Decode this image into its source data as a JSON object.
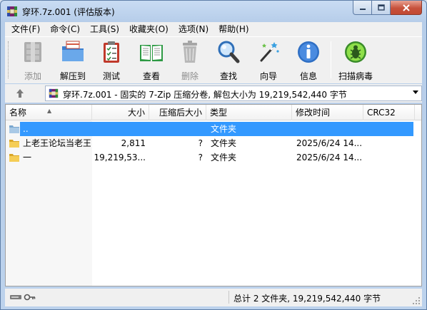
{
  "window": {
    "title": "穿环.7z.001 (评估版本)"
  },
  "menu": [
    {
      "label": "文件(F)"
    },
    {
      "label": "命令(C)"
    },
    {
      "label": "工具(S)"
    },
    {
      "label": "收藏夹(O)"
    },
    {
      "label": "选项(N)"
    },
    {
      "label": "帮助(H)"
    }
  ],
  "toolbar": {
    "add": "添加",
    "extract": "解压到",
    "test": "测试",
    "view": "查看",
    "delete": "删除",
    "find": "查找",
    "wizard": "向导",
    "info": "信息",
    "virus_scan": "扫描病毒"
  },
  "address": {
    "path": "穿环.7z.001 - 固实的 7-Zip 压缩分卷, 解包大小为 19,219,542,440 字节"
  },
  "columns": {
    "name": "名称",
    "size": "大小",
    "packed": "压缩后大小",
    "type": "类型",
    "modified": "修改时间",
    "crc": "CRC32"
  },
  "rows": [
    {
      "name": "..",
      "size": "",
      "packed": "",
      "type": "文件夹",
      "modified": ""
    },
    {
      "name": "上老王论坛当老王",
      "size": "2,811",
      "packed": "?",
      "type": "文件夹",
      "modified": "2025/6/24 14..."
    },
    {
      "name": "一",
      "size": "19,219,53...",
      "packed": "?",
      "type": "文件夹",
      "modified": "2025/6/24 14..."
    }
  ],
  "status": {
    "summary": "总计 2 文件夹, 19,219,542,440 字节"
  },
  "colors": {
    "selection": "#3399ff",
    "close_button": "#c7513b"
  }
}
